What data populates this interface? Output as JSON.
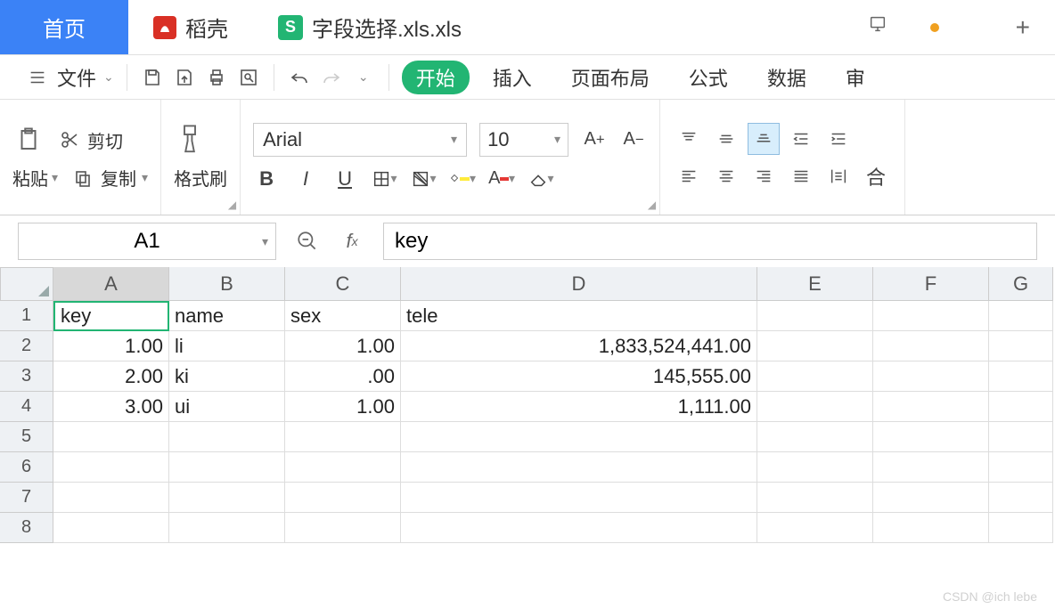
{
  "tabs": {
    "home": "首页",
    "daoke": "稻壳",
    "file": "字段选择.xls.xls"
  },
  "toolbar": {
    "file": "文件"
  },
  "ribbon_tabs": {
    "start": "开始",
    "insert": "插入",
    "layout": "页面布局",
    "formula": "公式",
    "data": "数据",
    "review": "审"
  },
  "clipboard": {
    "paste": "粘贴",
    "cut": "剪切",
    "copy": "复制",
    "format_painter": "格式刷"
  },
  "font": {
    "name": "Arial",
    "size": "10"
  },
  "namebox": "A1",
  "formula": "key",
  "columns": [
    "A",
    "B",
    "C",
    "D",
    "E",
    "F",
    "G"
  ],
  "col_widths": [
    "wA",
    "wB",
    "wC",
    "wD",
    "wE",
    "wF",
    "wG"
  ],
  "rows": [
    "1",
    "2",
    "3",
    "4",
    "5",
    "6",
    "7",
    "8"
  ],
  "cells": [
    [
      "key",
      "name",
      "sex",
      "tele",
      "",
      "",
      ""
    ],
    [
      "1.00",
      "li",
      "1.00",
      "1,833,524,441.00",
      "",
      "",
      ""
    ],
    [
      "2.00",
      "ki",
      ".00",
      "145,555.00",
      "",
      "",
      ""
    ],
    [
      "3.00",
      "ui",
      "1.00",
      "1,111.00",
      "",
      "",
      ""
    ],
    [
      "",
      "",
      "",
      "",
      "",
      "",
      ""
    ],
    [
      "",
      "",
      "",
      "",
      "",
      "",
      ""
    ],
    [
      "",
      "",
      "",
      "",
      "",
      "",
      ""
    ],
    [
      "",
      "",
      "",
      "",
      "",
      "",
      ""
    ]
  ],
  "chart_data": {
    "type": "table",
    "headers": [
      "key",
      "name",
      "sex",
      "tele"
    ],
    "rows": [
      [
        1.0,
        "li",
        1.0,
        1833524441.0
      ],
      [
        2.0,
        "ki",
        0.0,
        145555.0
      ],
      [
        3.0,
        "ui",
        1.0,
        1111.0
      ]
    ]
  },
  "watermark": "CSDN @ich lebe"
}
